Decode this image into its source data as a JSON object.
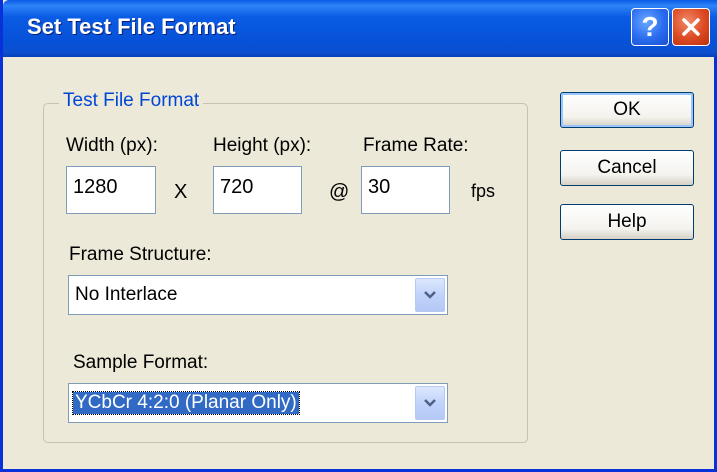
{
  "window": {
    "title": "Set Test File Format",
    "help_glyph": "?",
    "close_glyph": "✕"
  },
  "group": {
    "legend": "Test File Format"
  },
  "dimensions": {
    "width_label": "Width (px):",
    "width_value": "1280",
    "times_symbol": "X",
    "height_label": "Height (px):",
    "height_value": "720",
    "at_symbol": "@",
    "frame_rate_label": "Frame Rate:",
    "frame_rate_value": "30",
    "fps_unit": "fps"
  },
  "frame_structure": {
    "label": "Frame Structure:",
    "selected": "No Interlace"
  },
  "sample_format": {
    "label": "Sample Format:",
    "selected": "YCbCr 4:2:0 (Planar Only)"
  },
  "buttons": {
    "ok": "OK",
    "cancel": "Cancel",
    "help": "Help"
  },
  "icons": {
    "help": "question-mark-icon",
    "close": "close-x-icon",
    "dropdown": "chevron-down-icon"
  },
  "colors": {
    "titlebar": "#0752d8",
    "legend_text": "#0046d5",
    "selection": "#316ac5",
    "dialog_bg": "#ece9d8",
    "close_button": "#dc4a22"
  }
}
